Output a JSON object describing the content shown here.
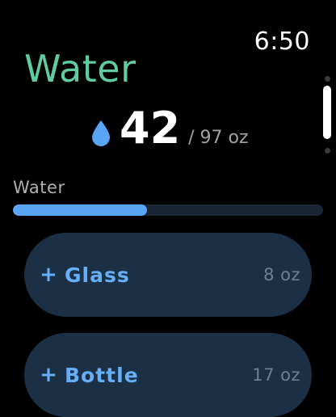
{
  "status_bar": {
    "time": "6:50"
  },
  "app": {
    "title": "Water"
  },
  "summary": {
    "current": "42",
    "goal": "/ 97 oz",
    "icon": "water-drop-icon"
  },
  "progress": {
    "label": "Water",
    "value": 42,
    "max": 97,
    "color": "#5AA4F4"
  },
  "actions": [
    {
      "plus": "+",
      "label": "Glass",
      "amount": "8 oz"
    },
    {
      "plus": "+",
      "label": "Bottle",
      "amount": "17 oz"
    }
  ],
  "colors": {
    "title": "#5ECBA1",
    "accent": "#66AEF7",
    "button_bg": "#1b2f45"
  }
}
